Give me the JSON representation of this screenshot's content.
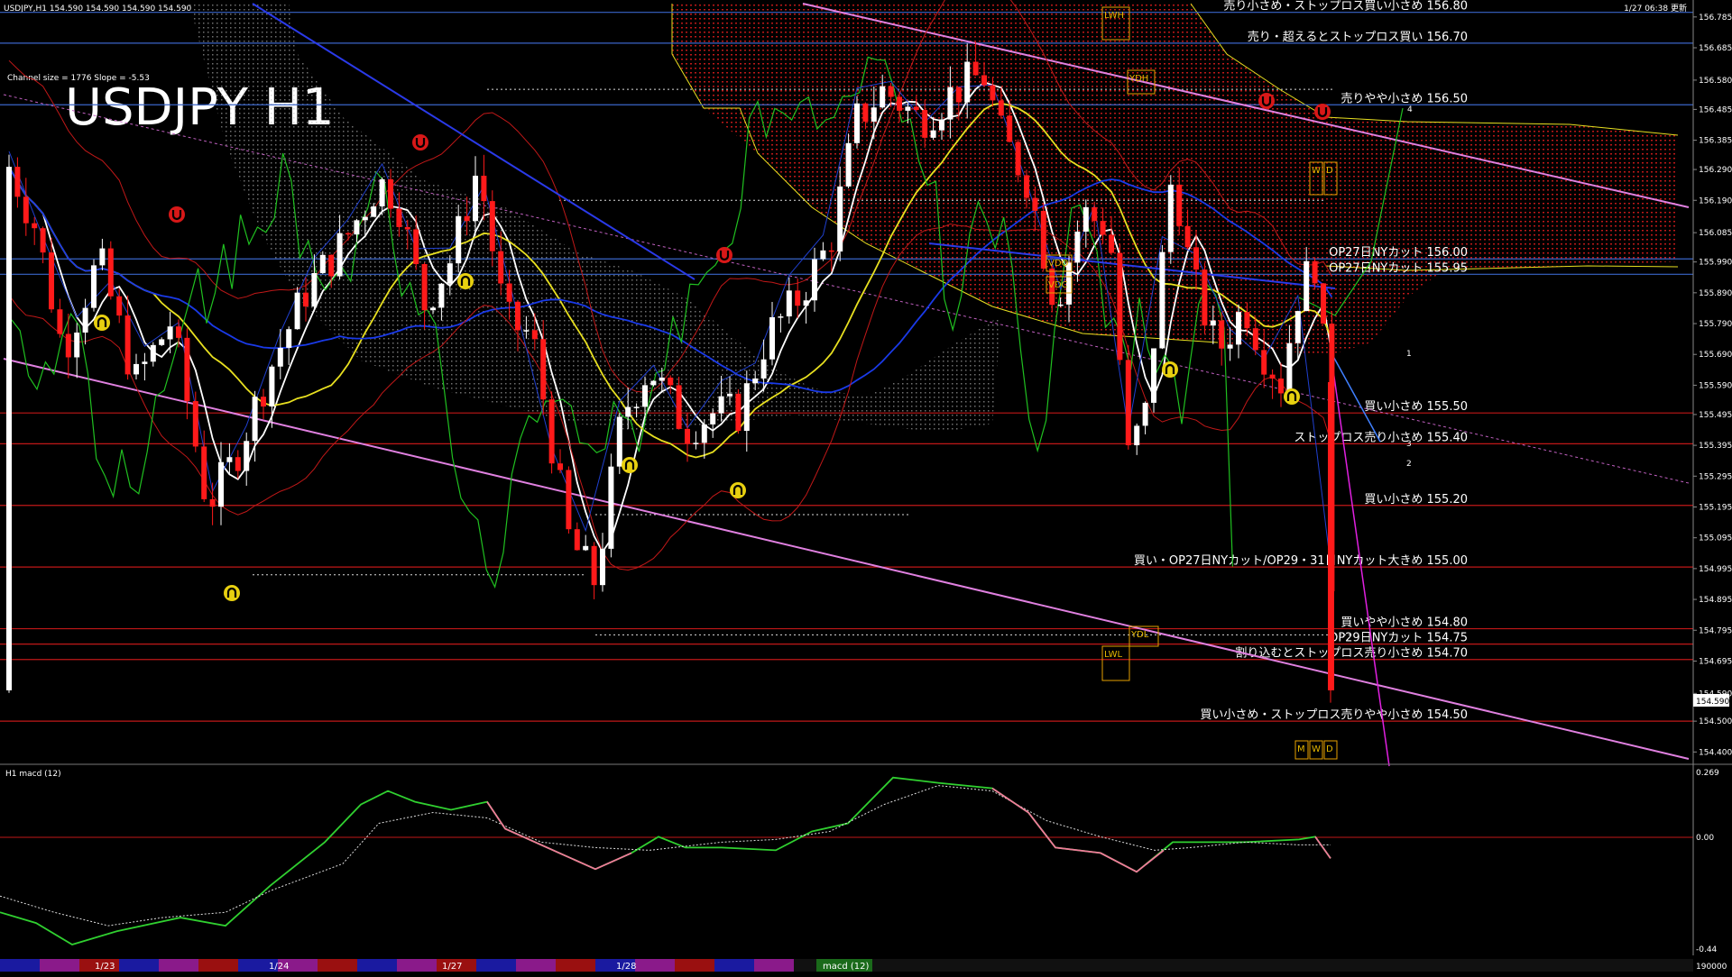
{
  "header": {
    "symbol_info": "USDJPY,H1  154.590 154.590 154.590 154.590",
    "updated": "1/27 06:38 更新",
    "channel_info": "Channel size = 1776 Slope = -5.53",
    "chart_title": "USDJPY H1"
  },
  "chart_data": {
    "type": "candlestick",
    "symbol": "USDJPY",
    "timeframe": "H1",
    "title": "USDJPY H1",
    "last_price": "154.590",
    "ylim": [
      154.36,
      156.84
    ],
    "price_ticks": [
      "156.785",
      "156.685",
      "156.580",
      "156.485",
      "156.385",
      "156.290",
      "156.190",
      "156.085",
      "155.990",
      "155.890",
      "155.790",
      "155.690",
      "155.590",
      "155.495",
      "155.395",
      "155.295",
      "155.195",
      "155.095",
      "154.995",
      "154.895",
      "154.795",
      "154.695",
      "154.590",
      "154.500",
      "154.400"
    ],
    "levels": [
      {
        "price": 156.8,
        "label": "売り小さめ・ストップロス買い小さめ 156.80",
        "color": "#3a64c8"
      },
      {
        "price": 156.7,
        "label": "売り・超えるとストップロス買い 156.70",
        "color": "#3a64c8"
      },
      {
        "price": 156.5,
        "label": "売りやや小さめ 156.50",
        "color": "#3a64c8"
      },
      {
        "price": 156.0,
        "label": "OP27日NYカット 156.00",
        "color": "#3a64c8"
      },
      {
        "price": 155.95,
        "label": "OP27日NYカット 155.95",
        "color": "#3a64c8"
      },
      {
        "price": 155.5,
        "label": "買い小さめ 155.50",
        "color": "#c01818"
      },
      {
        "price": 155.4,
        "label": "ストップロス売り小さめ 155.40",
        "color": "#c01818"
      },
      {
        "price": 155.2,
        "label": "買い小さめ 155.20",
        "color": "#c01818"
      },
      {
        "price": 155.0,
        "label": "買い・OP27日NYカット/OP29・31日NYカット大きめ 155.00",
        "color": "#c01818"
      },
      {
        "price": 154.8,
        "label": "買いやや小さめ 154.80",
        "color": "#c01818"
      },
      {
        "price": 154.75,
        "label": "OP29日NYカット 154.75",
        "color": "#c01818"
      },
      {
        "price": 154.7,
        "label": "割り込むとストップロス売り小さめ 154.70",
        "color": "#c01818"
      },
      {
        "price": 154.5,
        "label": "買い小さめ・ストップロス売りやや小さめ 154.50",
        "color": "#c01818"
      }
    ],
    "boxes": [
      "LWH",
      "YDH",
      "VDO",
      "VDC",
      "YDL",
      "LWL",
      "W",
      "D",
      "M",
      "W",
      "D"
    ],
    "wave_labels": [
      "1",
      "2",
      "3",
      "4"
    ],
    "date_labels": [
      "1/23",
      "1/24",
      "1/27",
      "1/28"
    ],
    "macd": {
      "label": "H1 macd (12)",
      "ylim": [
        -0.44,
        0.269
      ],
      "ticks": [
        "0.269",
        "0.00",
        "-0.44"
      ]
    },
    "bottom_tab": "macd (12)",
    "bottom_right": "190000"
  },
  "colors": {
    "background": "#000000",
    "up_candle": "#ffffff",
    "down_candle": "#ff1a1a",
    "ma_fast": "#ffffff",
    "ma_mid": "#e8e020",
    "ma_slow": "#1a3ae8",
    "channel": "#e080e0",
    "cloud": "#c01818",
    "lagging": "#20c020",
    "bands": "#c01818"
  }
}
